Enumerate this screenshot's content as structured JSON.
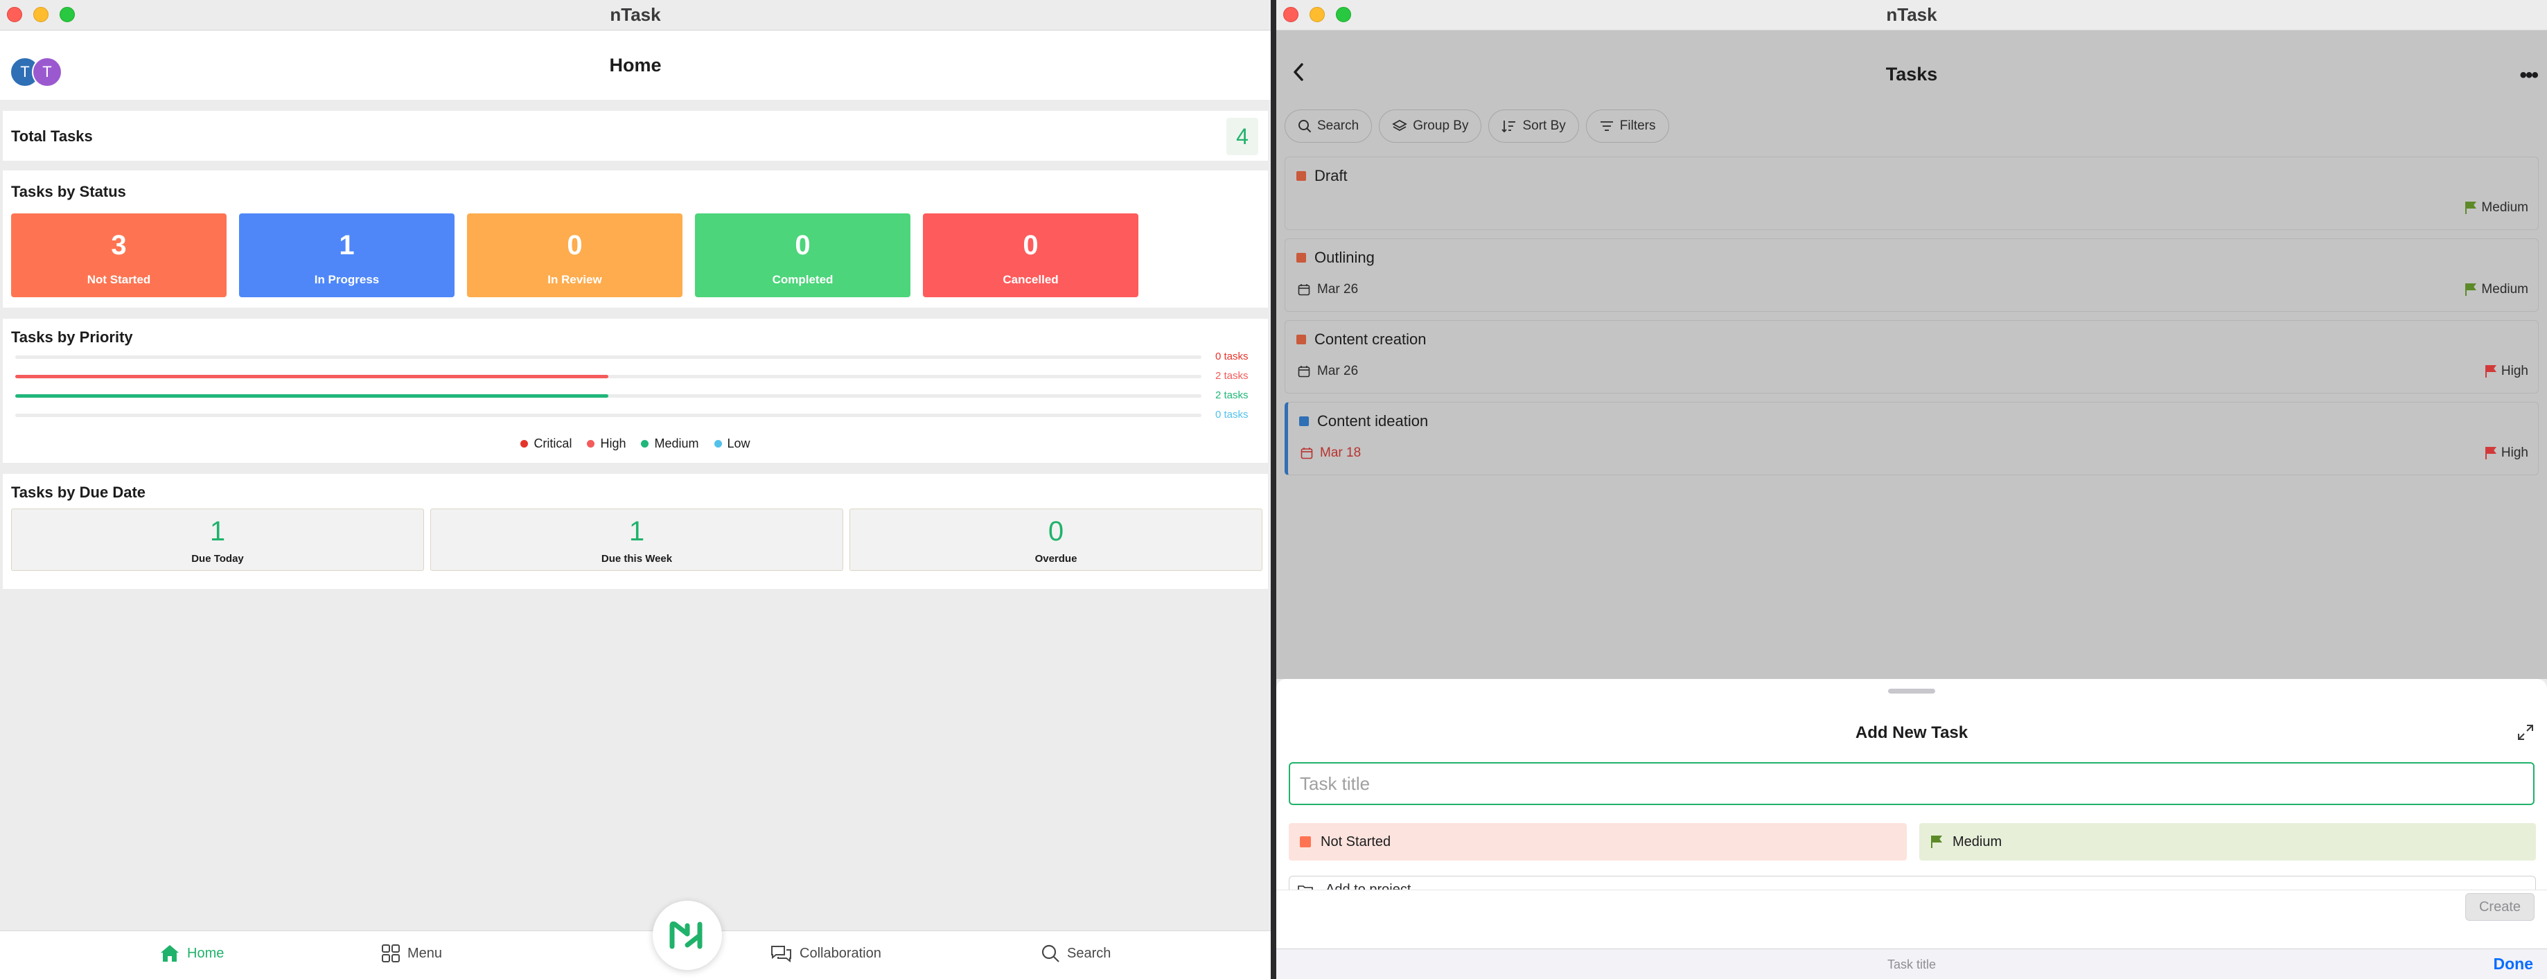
{
  "left_window": {
    "title": "nTask",
    "header": {
      "page_title": "Home",
      "avatars": [
        {
          "initial": "T",
          "color": "#2f6fb5"
        },
        {
          "initial": "T",
          "color": "#9b59d0"
        }
      ]
    },
    "total_tasks": {
      "label": "Total Tasks",
      "count": "4"
    },
    "tasks_by_status": {
      "title": "Tasks by Status",
      "tiles": [
        {
          "count": "3",
          "label": "Not Started",
          "color": "#fe7452"
        },
        {
          "count": "1",
          "label": "In Progress",
          "color": "#4f87f9"
        },
        {
          "count": "0",
          "label": "In Review",
          "color": "#feac4e"
        },
        {
          "count": "0",
          "label": "Completed",
          "color": "#4cd57a"
        },
        {
          "count": "0",
          "label": "Cancelled",
          "color": "#fe5b5c"
        }
      ]
    },
    "tasks_by_priority": {
      "title": "Tasks by Priority",
      "rows": [
        {
          "name": "Critical",
          "label": "0 tasks",
          "fraction": 0.0,
          "color": "#e5342b"
        },
        {
          "name": "High",
          "label": "2 tasks",
          "fraction": 0.5,
          "color": "#f45b5b"
        },
        {
          "name": "Medium",
          "label": "2 tasks",
          "fraction": 0.5,
          "color": "#20b77a"
        },
        {
          "name": "Low",
          "label": "0 tasks",
          "fraction": 0.0,
          "color": "#52c2ea"
        }
      ],
      "legend": [
        "Critical",
        "High",
        "Medium",
        "Low"
      ]
    },
    "tasks_by_due_date": {
      "title": "Tasks by Due Date",
      "tiles": [
        {
          "count": "1",
          "label": "Due Today"
        },
        {
          "count": "1",
          "label": "Due this Week"
        },
        {
          "count": "0",
          "label": "Overdue"
        }
      ]
    },
    "tabbar": {
      "home": "Home",
      "menu": "Menu",
      "collaboration": "Collaboration",
      "search": "Search",
      "accent": "#20b26b"
    }
  },
  "right_window": {
    "title": "nTask",
    "page_title": "Tasks",
    "chips": {
      "search": "Search",
      "group_by": "Group By",
      "sort_by": "Sort By",
      "filters": "Filters"
    },
    "tasks": [
      {
        "name": "Draft",
        "date": "",
        "priority": "Medium",
        "status_color": "#c95a3b",
        "flag_color": "#5d8a28"
      },
      {
        "name": "Outlining",
        "date": "Mar 26",
        "priority": "Medium",
        "status_color": "#c95a3b",
        "flag_color": "#5d8a28"
      },
      {
        "name": "Content creation",
        "date": "Mar 26",
        "priority": "High",
        "status_color": "#c95a3b",
        "flag_color": "#d23a3a"
      },
      {
        "name": "Content ideation",
        "date": "Mar 18",
        "priority": "High",
        "status_color": "#2f6fb5",
        "flag_color": "#d23a3a",
        "date_color": "#b8322e"
      }
    ],
    "add_task_sheet": {
      "title": "Add New Task",
      "title_placeholder": "Task title",
      "status": "Not Started",
      "priority": "Medium",
      "project": "Add to project",
      "create": "Create"
    },
    "keyboard_bar": {
      "hint": "Task title",
      "done": "Done"
    }
  }
}
